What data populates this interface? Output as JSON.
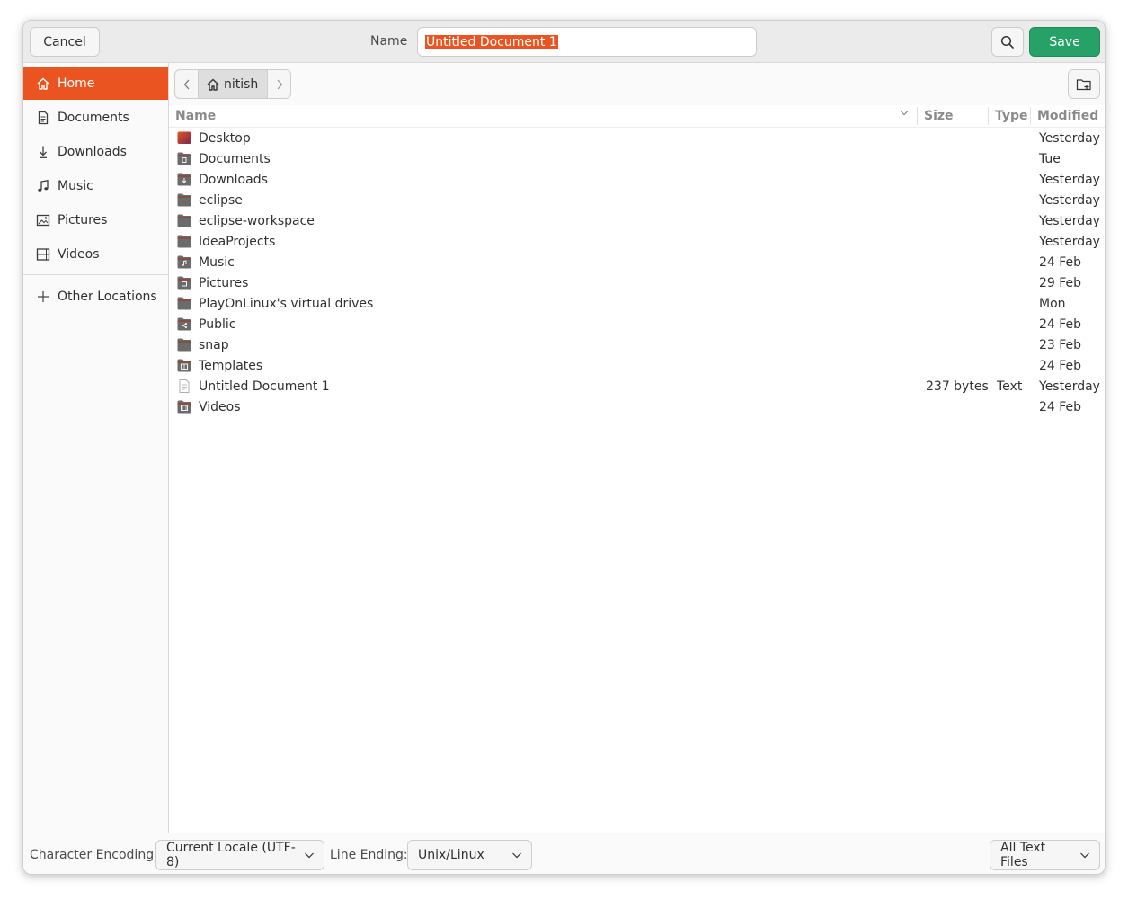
{
  "header": {
    "cancel_label": "Cancel",
    "name_label": "Name",
    "name_value": "Untitled Document 1",
    "save_label": "Save"
  },
  "colors": {
    "accent": "#e95420",
    "save": "#26a269"
  },
  "sidebar": {
    "items": [
      {
        "label": "Home",
        "icon": "home-icon",
        "active": true
      },
      {
        "label": "Documents",
        "icon": "document-icon"
      },
      {
        "label": "Downloads",
        "icon": "download-icon"
      },
      {
        "label": "Music",
        "icon": "music-icon"
      },
      {
        "label": "Pictures",
        "icon": "picture-icon"
      },
      {
        "label": "Videos",
        "icon": "video-icon"
      }
    ],
    "other_locations": "Other Locations"
  },
  "pathbar": {
    "current": "nitish"
  },
  "columns": {
    "name": "Name",
    "size": "Size",
    "type": "Type",
    "modified": "Modified"
  },
  "files": [
    {
      "name": "Desktop",
      "size": "",
      "type": "",
      "modified": "Yesterday",
      "icon": "desktop-folder-icon"
    },
    {
      "name": "Documents",
      "size": "",
      "type": "",
      "modified": "Tue",
      "icon": "documents-folder-icon"
    },
    {
      "name": "Downloads",
      "size": "",
      "type": "",
      "modified": "Yesterday",
      "icon": "downloads-folder-icon"
    },
    {
      "name": "eclipse",
      "size": "",
      "type": "",
      "modified": "Yesterday",
      "icon": "folder-icon"
    },
    {
      "name": "eclipse-workspace",
      "size": "",
      "type": "",
      "modified": "Yesterday",
      "icon": "folder-icon"
    },
    {
      "name": "IdeaProjects",
      "size": "",
      "type": "",
      "modified": "Yesterday",
      "icon": "folder-icon"
    },
    {
      "name": "Music",
      "size": "",
      "type": "",
      "modified": "24 Feb",
      "icon": "music-folder-icon"
    },
    {
      "name": "Pictures",
      "size": "",
      "type": "",
      "modified": "29 Feb",
      "icon": "pictures-folder-icon"
    },
    {
      "name": "PlayOnLinux's virtual drives",
      "size": "",
      "type": "",
      "modified": "Mon",
      "icon": "folder-icon"
    },
    {
      "name": "Public",
      "size": "",
      "type": "",
      "modified": "24 Feb",
      "icon": "public-folder-icon"
    },
    {
      "name": "snap",
      "size": "",
      "type": "",
      "modified": "23 Feb",
      "icon": "folder-icon"
    },
    {
      "name": "Templates",
      "size": "",
      "type": "",
      "modified": "24 Feb",
      "icon": "templates-folder-icon"
    },
    {
      "name": "Untitled Document 1",
      "size": "237 bytes",
      "type": "Text",
      "modified": "Yesterday",
      "icon": "text-file-icon"
    },
    {
      "name": "Videos",
      "size": "",
      "type": "",
      "modified": "24 Feb",
      "icon": "videos-folder-icon"
    }
  ],
  "footer": {
    "encoding_label": "Character Encoding:",
    "encoding_value": "Current Locale (UTF-8)",
    "line_ending_label": "Line Ending:",
    "line_ending_value": "Unix/Linux",
    "filter_value": "All Text Files"
  }
}
